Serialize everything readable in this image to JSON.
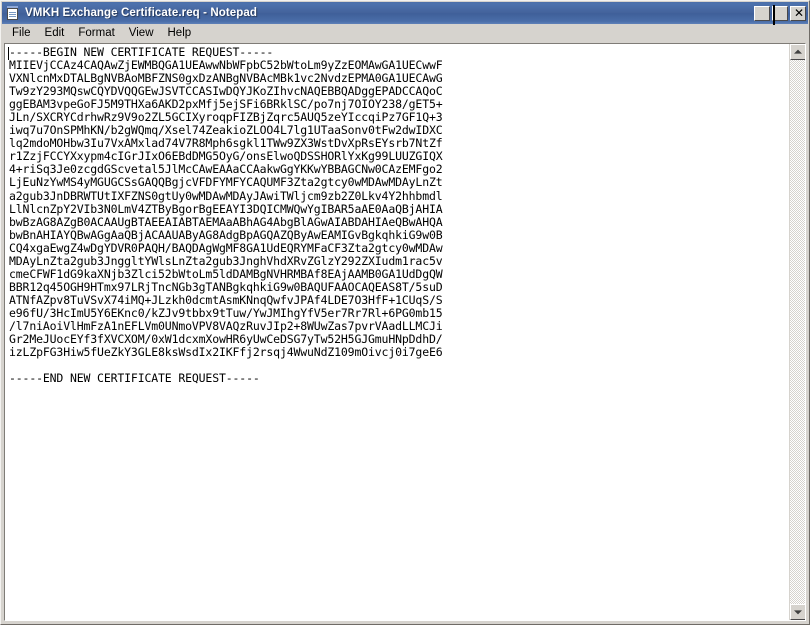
{
  "window": {
    "title": "VMKH Exchange Certificate.req - Notepad",
    "icon": "notepad-document-icon",
    "controls": {
      "minimize_label": "_",
      "maximize_label": "□",
      "close_label": "✕"
    },
    "titlebar_color": "#4a6ea9",
    "face_color": "#d6d3ce"
  },
  "menubar": {
    "items": [
      {
        "label": "File"
      },
      {
        "label": "Edit"
      },
      {
        "label": "Format"
      },
      {
        "label": "View"
      },
      {
        "label": "Help"
      }
    ]
  },
  "editor": {
    "wordwrap": true,
    "content": "-----BEGIN NEW CERTIFICATE REQUEST-----\nMIIEVjCCAz4CAQAwZjEWMBQGA1UEAwwNbWFpbC52bWtoLm9yZzEOMAwGA1UECwwF\nVXNlcnMxDTALBgNVBAoMBFZNS0gxDzANBgNVBAcMBk1vc2NvdzEPMA0GA1UECAwG\nTw9zY293MQswCQYDVQQGEwJSVTCCASIwDQYJKoZIhvcNAQEBBQADggEPADCCAQoC\nggEBAM3vpeGoFJ5M9THXa6AKD2pxMfj5ejSFi6BRklSC/po7nj7OIOY238/gET5+\nJLn/SXCRYCdrhwRz9V9o2ZL5GCIXyroqpFIZBjZqrc5AUQ5zeYIccqiPz7GF1Q+3\niwq7u7OnSPMhKN/b2gWQmq/Xsel74ZeakioZLOO4L7lg1UTaaSonv0tFw2dwIDXC\nlq2mdoMOHbw3Iu7VxAMxlad74V7R8Mph6sgkl1TWw9ZX3WstDvXpRsEYsrb7NtZf\nr1ZzjFCCYXxypm4cIGrJIxO6EBdDMG5OyG/onsElwoQDSSHORlYxKg99LUUZGIQX\n4+riSq3Je0zcgdGScvetal5JlMcCAwEAAaCCAakwGgYKKwYBBAGCNw0CAzEMFgo2\nLjEuNzYwMS4yMGUGCSsGAQQBgjcVFDFYMFYCAQUMF3Zta2gtcy0wMDAwMDAyLnZt\na2gub3JnDBRWTUtIXFZNS0gtUy0wMDAwMDAyJAwiTWljcm9zb2Z0Lkv4Y2hhbmdl\nLlNlcnZpY2VIb3N0LmV4ZTByBgorBgEEAYI3DQICMWQwYgIBAR5aAE0AaQBjAHIA\nbwBzAG8AZgB0ACAAUgBTAEEAIABTAEMAaABhAG4AbgBlAGwAIABDAHIAeQBwAHQA\nbwBnAHIAYQBwAGgAaQBjACAAUAByAG8AdgBpAGQAZQByAwEAMIGvBgkqhkiG9w0B\nCQ4xgaEwgZ4wDgYDVR0PAQH/BAQDAgWgMF8GA1UdEQRYMFaCF3Zta2gtcy0wMDAw\nMDAyLnZta2gub3JnggltYWlsLnZta2gub3JnghVhdXRvZGlzY292ZXIudm1rac5v\ncmeCFWF1dG9kaXNjb3Zlci52bWtoLm5ldDAMBgNVHRMBAf8EAjAAMB0GA1UdDgQW\nBBR12q45OGH9HTmx97LRjTncNGb3gTANBgkqhkiG9w0BAQUFAAOCAQEAS8T/5suD\nATNfAZpv8TuVSvX74iMQ+JLzkh0dcmtAsmKNnqQwfvJPAf4LDE7O3HfF+1CUqS/S\ne96fU/3HcImU5Y6EKnc0/kZJv9tbbx9tTuw/YwJMIhgYfV5er7Rr7Rl+6PG0mb15\n/l7niAoiVlHmFzA1nEFLVm0UNmoVPV8VAQzRuvJIp2+8WUwZas7pvrVAadLLMCJi\nGr2MeJUocEYf3fXVCXOM/0xW1dcxmXowHR6yUwCeDSG7yTw52H5GJGmuHNpDdhD/\nizLZpFG3Hiw5fUeZkY3GLE8ksWsdIx2IKFfj2rsqj4WwuNdZ109mOivcj0i7geE6\n\n-----END NEW CERTIFICATE REQUEST-----"
  },
  "scrollbar": {
    "up_arrow": "scroll-up-arrow",
    "down_arrow": "scroll-down-arrow"
  }
}
